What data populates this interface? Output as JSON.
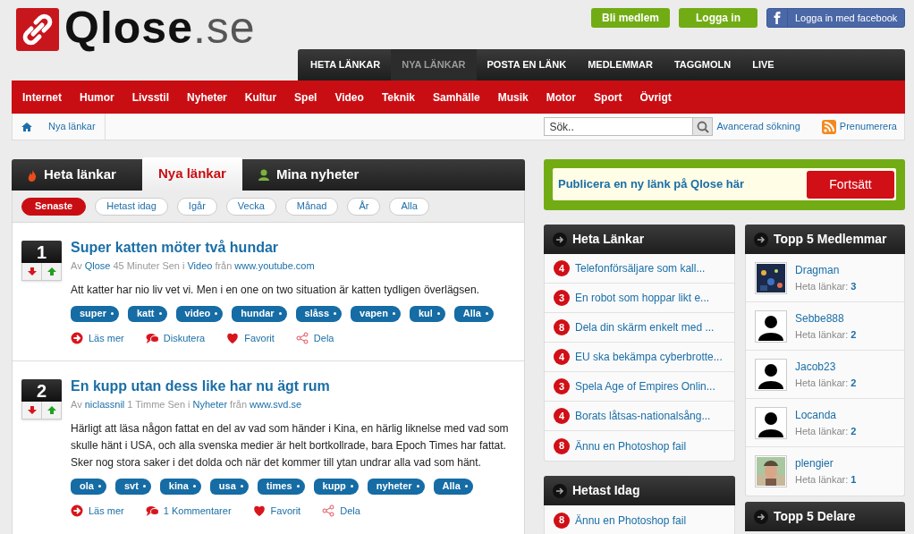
{
  "site": {
    "logo_text": "Qlose",
    "logo_suffix": ".se"
  },
  "account_buttons": [
    {
      "label": "Bli medlem",
      "kind": "green"
    },
    {
      "label": "Logga in",
      "kind": "green"
    },
    {
      "label": "Logga in med facebook",
      "kind": "facebook"
    }
  ],
  "main_nav": [
    {
      "label": "HETA LÄNKAR",
      "selected": false
    },
    {
      "label": "NYA LÄNKAR",
      "selected": true
    },
    {
      "label": "POSTA EN LÄNK",
      "selected": false
    },
    {
      "label": "MEDLEMMAR",
      "selected": false
    },
    {
      "label": "TAGGMOLN",
      "selected": false
    },
    {
      "label": "LIVE",
      "selected": false
    }
  ],
  "categories": [
    "Internet",
    "Humor",
    "Livsstil",
    "Nyheter",
    "Kultur",
    "Spel",
    "Video",
    "Teknik",
    "Samhälle",
    "Musik",
    "Motor",
    "Sport",
    "Övrigt"
  ],
  "breadcrumb": [
    "Nya länkar"
  ],
  "search": {
    "placeholder": "Sök..",
    "advanced": "Avancerad sökning"
  },
  "subscribe": "Prenumerera",
  "tabs": [
    {
      "label": "Heta länkar",
      "kind": "flame",
      "selected": false
    },
    {
      "label": "Nya länkar",
      "kind": "plain",
      "selected": true
    },
    {
      "label": "Mina nyheter",
      "kind": "person",
      "selected": false
    }
  ],
  "filters": [
    {
      "label": "Senaste",
      "selected": true
    },
    {
      "label": "Hetast idag",
      "selected": false
    },
    {
      "label": "Igår",
      "selected": false
    },
    {
      "label": "Vecka",
      "selected": false
    },
    {
      "label": "Månad",
      "selected": false
    },
    {
      "label": "År",
      "selected": false
    },
    {
      "label": "Alla",
      "selected": false
    }
  ],
  "posts": [
    {
      "rank": "1",
      "title": "Super katten möter två hundar",
      "meta": {
        "by": "Av",
        "author": "Qlose",
        "time": "45 Minuter Sen",
        "in": "i",
        "category": "Video",
        "from": "från",
        "source": "www.youtube.com"
      },
      "text": "Att katter har nio liv vet vi. Men i en one on two situation är katten tydligen överlägsen.",
      "tags": [
        "super",
        "katt",
        "video",
        "hundar",
        "slåss",
        "vapen",
        "kul",
        "Alla"
      ],
      "actions": [
        {
          "kind": "read",
          "label": "Läs mer"
        },
        {
          "kind": "discuss",
          "label": "Diskutera"
        },
        {
          "kind": "favorite",
          "label": "Favorit"
        },
        {
          "kind": "share",
          "label": "Dela"
        }
      ]
    },
    {
      "rank": "2",
      "title": "En kupp utan dess like har nu ägt rum",
      "meta": {
        "by": "Av",
        "author": "niclassnil",
        "time": "1 Timme Sen",
        "in": "i",
        "category": "Nyheter",
        "from": "från",
        "source": "www.svd.se"
      },
      "text": "Härligt att läsa någon fattat en del av vad som händer i Kina, en härlig liknelse med vad som skulle hänt i USA, och alla svenska medier är helt bortkollrade, bara Epoch Times har fattat. Sker nog stora saker i det dolda och när det kommer till ytan undrar alla vad som hänt.",
      "tags": [
        "ola",
        "svt",
        "kina",
        "usa",
        "times",
        "kupp",
        "nyheter",
        "Alla"
      ],
      "actions": [
        {
          "kind": "read",
          "label": "Läs mer"
        },
        {
          "kind": "discuss",
          "label": "1 Kommentarer"
        },
        {
          "kind": "favorite",
          "label": "Favorit"
        },
        {
          "kind": "share",
          "label": "Dela"
        }
      ]
    }
  ],
  "publish": {
    "text": "Publicera en ny länk på Qlose här",
    "button": "Fortsätt"
  },
  "hot_links": {
    "title": "Heta Länkar",
    "items": [
      {
        "count": "4",
        "label": "Telefonförsäljare som kall..."
      },
      {
        "count": "3",
        "label": "En robot som hoppar likt e..."
      },
      {
        "count": "8",
        "label": "Dela din skärm enkelt med ..."
      },
      {
        "count": "4",
        "label": "EU ska bekämpa cyberbrotte..."
      },
      {
        "count": "3",
        "label": "Spela Age of Empires Onlin..."
      },
      {
        "count": "4",
        "label": "Borats låtsas-nationalsång..."
      },
      {
        "count": "8",
        "label": "Ännu en Photoshop fail"
      }
    ]
  },
  "hot_today": {
    "title": "Hetast Idag",
    "items": [
      {
        "count": "8",
        "label": "Ännu en Photoshop fail"
      }
    ]
  },
  "top_members": {
    "title": "Topp 5 Medlemmar",
    "items": [
      {
        "name": "Dragman",
        "stat_label": "Heta länkar:",
        "stat": "3",
        "kind": "picture"
      },
      {
        "name": "Sebbe888",
        "stat_label": "Heta länkar:",
        "stat": "2",
        "kind": "silhouette"
      },
      {
        "name": "Jacob23",
        "stat_label": "Heta länkar:",
        "stat": "2",
        "kind": "silhouette"
      },
      {
        "name": "Locanda",
        "stat_label": "Heta länkar:",
        "stat": "2",
        "kind": "silhouette"
      },
      {
        "name": "plengier",
        "stat_label": "Heta länkar:",
        "stat": "1",
        "kind": "picture"
      }
    ]
  },
  "top_sharers": {
    "title": "Topp 5 Delare"
  }
}
